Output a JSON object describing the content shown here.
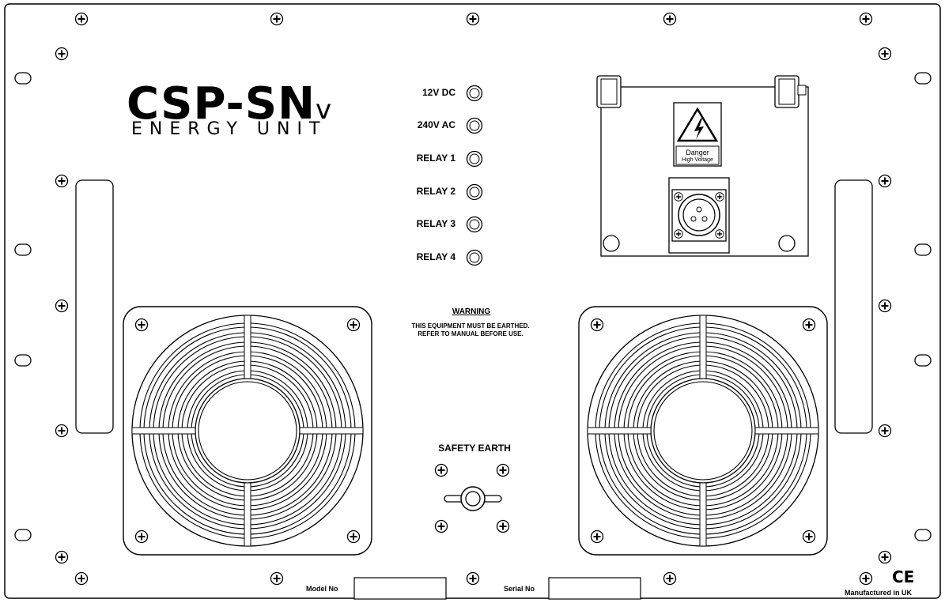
{
  "brand": {
    "name": "CSP-SN",
    "suffix": "v",
    "subtitle": "ENERGY UNIT"
  },
  "indicators": [
    {
      "label": "12V DC"
    },
    {
      "label": "240V AC"
    },
    {
      "label": "RELAY 1"
    },
    {
      "label": "RELAY 2"
    },
    {
      "label": "RELAY 3"
    },
    {
      "label": "RELAY 4"
    }
  ],
  "warning": {
    "title": "WARNING",
    "body": "THIS EQUIPMENT MUST BE EARTHED. REFER TO MANUAL BEFORE USE."
  },
  "danger_plate": {
    "title": "Danger",
    "subtitle": "High Voltage"
  },
  "earth": {
    "label": "SAFETY EARTH"
  },
  "footer": {
    "model_label": "Model No",
    "serial_label": "Serial No",
    "manufactured": "Manufactured in UK",
    "ce_mark": "CE"
  },
  "colors": {
    "line": "#000000",
    "background": "#ffffff"
  }
}
